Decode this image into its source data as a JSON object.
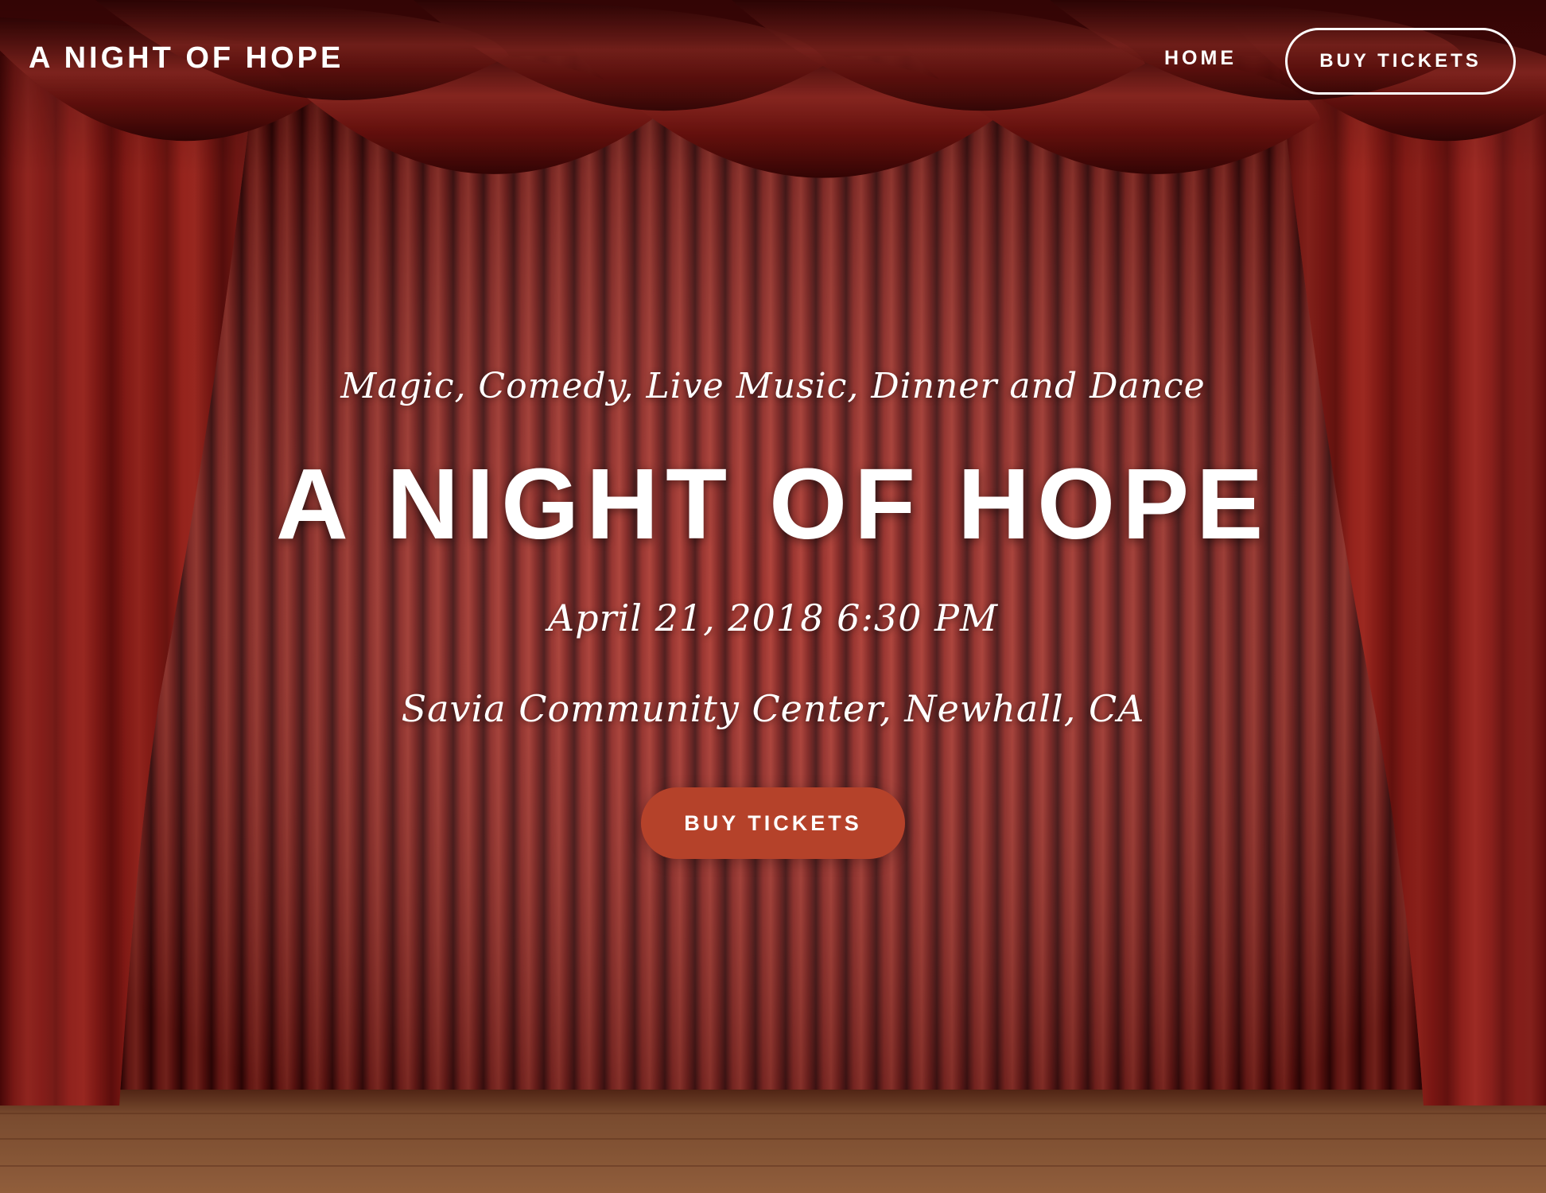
{
  "header": {
    "site_title": "A NIGHT OF HOPE",
    "nav": {
      "home_label": "HOME",
      "buy_tickets_label": "BUY TICKETS"
    }
  },
  "hero": {
    "tagline": "Magic, Comedy, Live Music, Dinner and Dance",
    "title": "A NIGHT OF HOPE",
    "date": "April 21, 2018 6:30 PM",
    "venue": "Savia Community Center, Newhall, CA",
    "cta_label": "BUY TICKETS"
  },
  "colors": {
    "curtain_red": "#8e1a16",
    "curtain_dark": "#3a0606",
    "curtain_highlight": "#c03a30",
    "stage_floor": "#8a5636",
    "cta_background": "#b5422a",
    "text": "#ffffff"
  },
  "background": {
    "image": "theater-stage-red-curtain"
  }
}
